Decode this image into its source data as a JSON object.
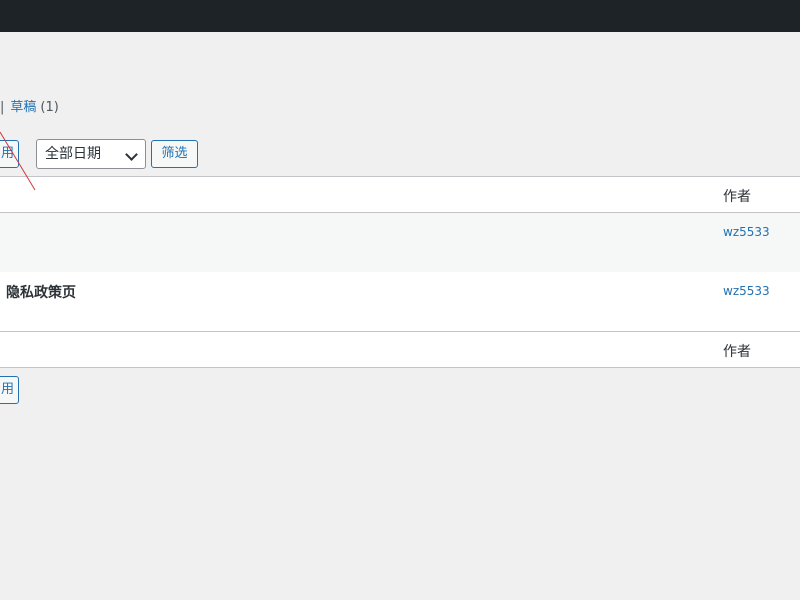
{
  "status_links": {
    "separator": "|",
    "draft_label": "草稿",
    "draft_count": "(1)"
  },
  "bulk_actions": {
    "apply_label": "用"
  },
  "date_filter": {
    "selected": "全部日期"
  },
  "filter_button": {
    "label": "筛选"
  },
  "table": {
    "author_header": "作者",
    "rows": [
      {
        "title": "",
        "author": "wz5533"
      },
      {
        "title": "隐私政策页",
        "author": "wz5533"
      }
    ]
  },
  "colors": {
    "admin_bar": "#1d2327",
    "link": "#2271b1",
    "background": "#f0f0f1",
    "annotation": "#d63638"
  }
}
